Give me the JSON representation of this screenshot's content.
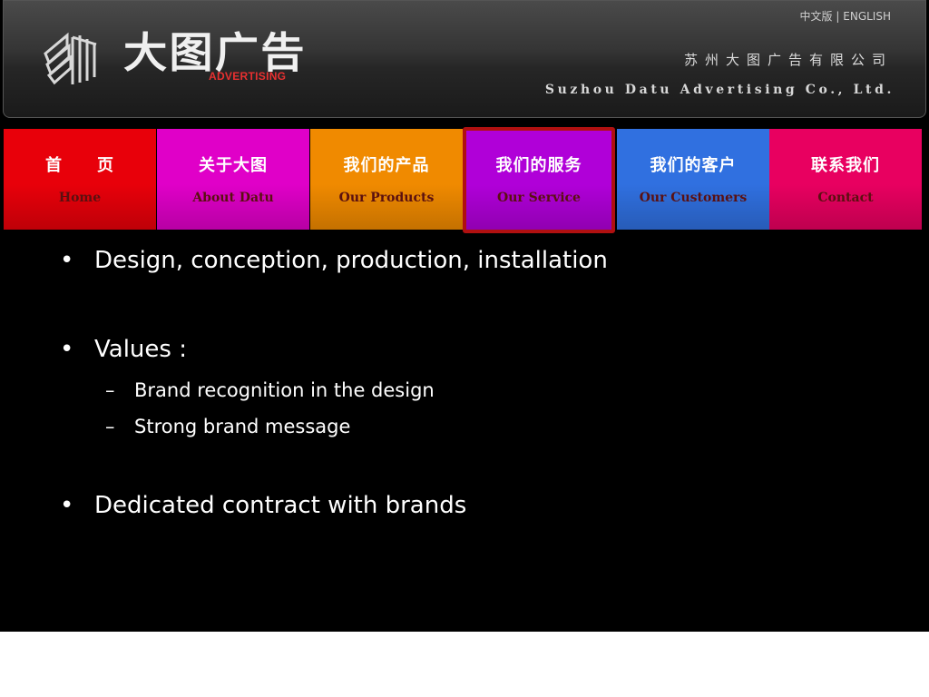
{
  "header": {
    "logo_cn": "大图广告",
    "logo_en": "ADVERTISING",
    "lang_cn": "中文版",
    "lang_sep": "|",
    "lang_en": "ENGLISH",
    "company_cn": "苏州大图广告有限公司",
    "company_en": "Suzhou Datu Advertising Co., Ltd."
  },
  "nav": {
    "items": [
      {
        "cn": "首　　页",
        "en": "Home",
        "color": "#e8000a",
        "active": false
      },
      {
        "cn": "关于大图",
        "en": "About Datu",
        "color": "#e000c8",
        "active": false
      },
      {
        "cn": "我们的产品",
        "en": "Our Products",
        "color": "#f08a00",
        "active": false
      },
      {
        "cn": "我们的服务",
        "en": "Our Service",
        "color": "#b000d8",
        "active": true
      },
      {
        "cn": "我们的客户",
        "en": "Our Customers",
        "color": "#3070e0",
        "active": false
      },
      {
        "cn": "联系我们",
        "en": "Contact",
        "color": "#e80060",
        "active": false
      }
    ]
  },
  "content": {
    "bullet_symbol": "•",
    "dash_symbol": "–",
    "bullet1": "Design, conception, production, installation",
    "bullet2": "Values :",
    "sub1": "Brand recognition in the design",
    "sub2": "Strong brand message",
    "bullet3": "Dedicated contract with brands"
  }
}
